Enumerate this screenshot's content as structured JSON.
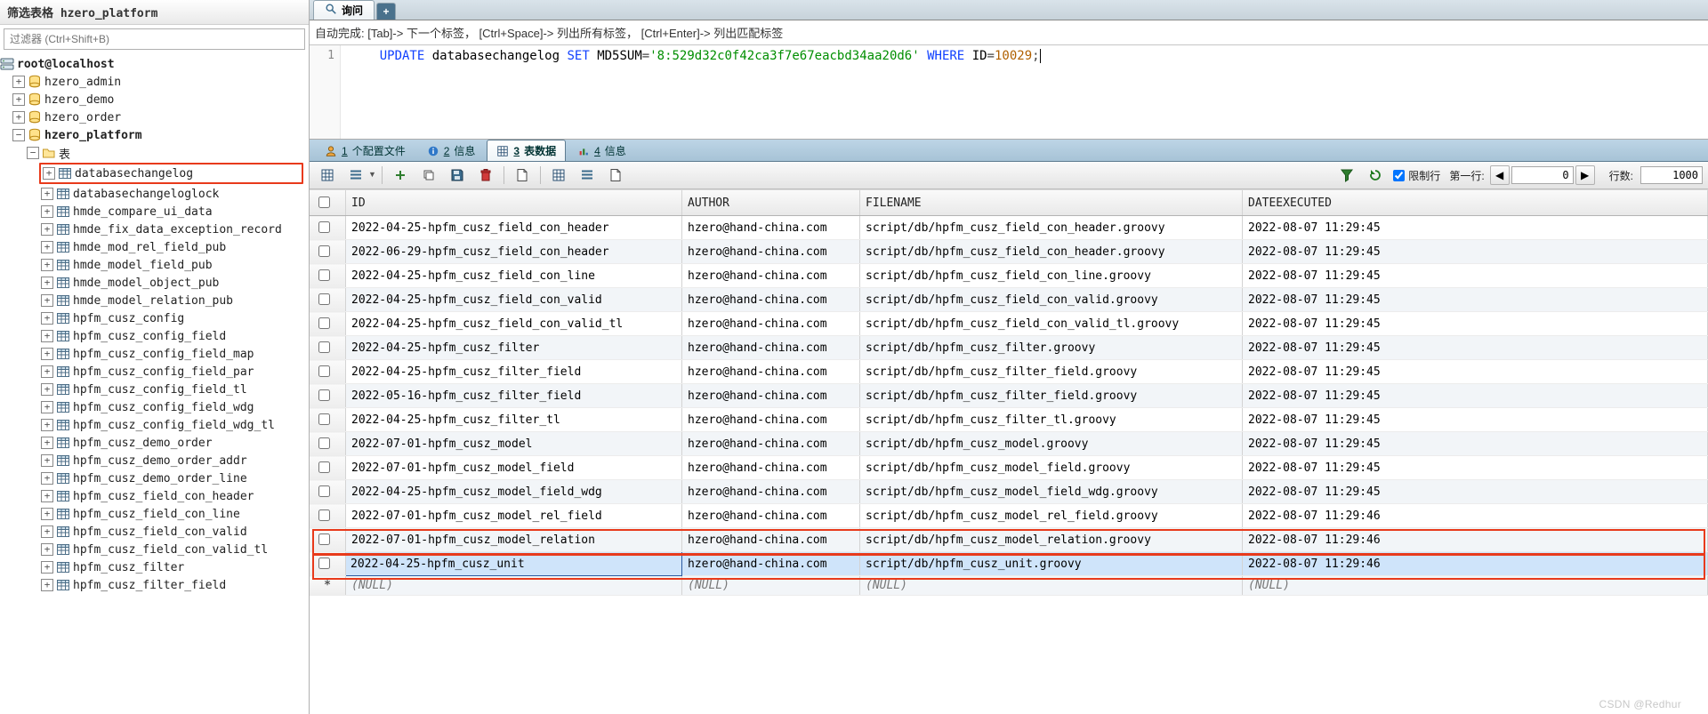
{
  "sidebar": {
    "title": "筛选表格 hzero_platform",
    "filter_placeholder": "过滤器 (Ctrl+Shift+B)",
    "root": "root@localhost",
    "databases": [
      "hzero_admin",
      "hzero_demo",
      "hzero_order"
    ],
    "active_db": "hzero_platform",
    "tables_label": "表",
    "highlighted_table": "databasechangelog",
    "tables": [
      "databasechangeloglock",
      "hmde_compare_ui_data",
      "hmde_fix_data_exception_record",
      "hmde_mod_rel_field_pub",
      "hmde_model_field_pub",
      "hmde_model_object_pub",
      "hmde_model_relation_pub",
      "hpfm_cusz_config",
      "hpfm_cusz_config_field",
      "hpfm_cusz_config_field_map",
      "hpfm_cusz_config_field_par",
      "hpfm_cusz_config_field_tl",
      "hpfm_cusz_config_field_wdg",
      "hpfm_cusz_config_field_wdg_tl",
      "hpfm_cusz_demo_order",
      "hpfm_cusz_demo_order_addr",
      "hpfm_cusz_demo_order_line",
      "hpfm_cusz_field_con_header",
      "hpfm_cusz_field_con_line",
      "hpfm_cusz_field_con_valid",
      "hpfm_cusz_field_con_valid_tl",
      "hpfm_cusz_filter",
      "hpfm_cusz_filter_field"
    ]
  },
  "main": {
    "tab_query": "询问",
    "hint": "自动完成:   [Tab]-> 下一个标签，  [Ctrl+Space]-> 列出所有标签，  [Ctrl+Enter]-> 列出匹配标签",
    "sql": {
      "line_no": "1",
      "kw_update": "UPDATE",
      "table": "databasechangelog",
      "kw_set": "SET",
      "col": "MD5SUM",
      "str": "'8:529d32c0f42ca3f7e67eacbd34aa20d6'",
      "kw_where": "WHERE",
      "id_col": "ID",
      "id_val": "10029"
    },
    "subtabs": {
      "t1": {
        "num": "1",
        "label": "个配置文件"
      },
      "t2": {
        "num": "2",
        "label": "信息"
      },
      "t3": {
        "num": "3",
        "label": "表数据"
      },
      "t4": {
        "num": "4",
        "label": "信息"
      }
    },
    "toolbar": {
      "limit_label": "限制行",
      "first_row_label": "第一行:",
      "first_row_value": "0",
      "rows_label": "行数:",
      "rows_value": "1000"
    },
    "grid": {
      "headers": {
        "id": "ID",
        "author": "AUTHOR",
        "filename": "FILENAME",
        "dateexec": "DATEEXECUTED"
      },
      "rows": [
        {
          "id": "2022-04-25-hpfm_cusz_field_con_header",
          "author": "hzero@hand-china.com",
          "filename": "script/db/hpfm_cusz_field_con_header.groovy",
          "dateexec": "2022-08-07 11:29:45"
        },
        {
          "id": "2022-06-29-hpfm_cusz_field_con_header",
          "author": "hzero@hand-china.com",
          "filename": "script/db/hpfm_cusz_field_con_header.groovy",
          "dateexec": "2022-08-07 11:29:45"
        },
        {
          "id": "2022-04-25-hpfm_cusz_field_con_line",
          "author": "hzero@hand-china.com",
          "filename": "script/db/hpfm_cusz_field_con_line.groovy",
          "dateexec": "2022-08-07 11:29:45"
        },
        {
          "id": "2022-04-25-hpfm_cusz_field_con_valid",
          "author": "hzero@hand-china.com",
          "filename": "script/db/hpfm_cusz_field_con_valid.groovy",
          "dateexec": "2022-08-07 11:29:45"
        },
        {
          "id": "2022-04-25-hpfm_cusz_field_con_valid_tl",
          "author": "hzero@hand-china.com",
          "filename": "script/db/hpfm_cusz_field_con_valid_tl.groovy",
          "dateexec": "2022-08-07 11:29:45"
        },
        {
          "id": "2022-04-25-hpfm_cusz_filter",
          "author": "hzero@hand-china.com",
          "filename": "script/db/hpfm_cusz_filter.groovy",
          "dateexec": "2022-08-07 11:29:45"
        },
        {
          "id": "2022-04-25-hpfm_cusz_filter_field",
          "author": "hzero@hand-china.com",
          "filename": "script/db/hpfm_cusz_filter_field.groovy",
          "dateexec": "2022-08-07 11:29:45"
        },
        {
          "id": "2022-05-16-hpfm_cusz_filter_field",
          "author": "hzero@hand-china.com",
          "filename": "script/db/hpfm_cusz_filter_field.groovy",
          "dateexec": "2022-08-07 11:29:45"
        },
        {
          "id": "2022-04-25-hpfm_cusz_filter_tl",
          "author": "hzero@hand-china.com",
          "filename": "script/db/hpfm_cusz_filter_tl.groovy",
          "dateexec": "2022-08-07 11:29:45"
        },
        {
          "id": "2022-07-01-hpfm_cusz_model",
          "author": "hzero@hand-china.com",
          "filename": "script/db/hpfm_cusz_model.groovy",
          "dateexec": "2022-08-07 11:29:45"
        },
        {
          "id": "2022-07-01-hpfm_cusz_model_field",
          "author": "hzero@hand-china.com",
          "filename": "script/db/hpfm_cusz_model_field.groovy",
          "dateexec": "2022-08-07 11:29:45"
        },
        {
          "id": "2022-04-25-hpfm_cusz_model_field_wdg",
          "author": "hzero@hand-china.com",
          "filename": "script/db/hpfm_cusz_model_field_wdg.groovy",
          "dateexec": "2022-08-07 11:29:45"
        },
        {
          "id": "2022-07-01-hpfm_cusz_model_rel_field",
          "author": "hzero@hand-china.com",
          "filename": "script/db/hpfm_cusz_model_rel_field.groovy",
          "dateexec": "2022-08-07 11:29:46"
        },
        {
          "id": "2022-07-01-hpfm_cusz_model_relation",
          "author": "hzero@hand-china.com",
          "filename": "script/db/hpfm_cusz_model_relation.groovy",
          "dateexec": "2022-08-07 11:29:46"
        },
        {
          "id": "2022-04-25-hpfm_cusz_unit",
          "author": "hzero@hand-china.com",
          "filename": "script/db/hpfm_cusz_unit.groovy",
          "dateexec": "2022-08-07 11:29:46"
        }
      ],
      "null_text": "(NULL)",
      "selected_row_index": 14
    }
  },
  "watermark": "CSDN @Redhur"
}
